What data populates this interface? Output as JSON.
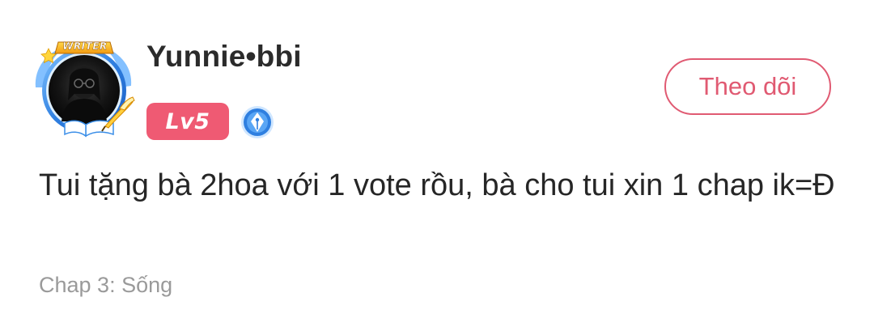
{
  "comment": {
    "avatar": {
      "frame_label": "WRITER",
      "frame_color": "#3a8ee8",
      "icon_names": [
        "writer-frame-icon",
        "quill-pen-icon",
        "open-book-icon",
        "star-icon"
      ]
    },
    "username": "Yunnie•bbi",
    "level_badge": "Lv5",
    "writer_badge_icon": "fountain-pen-nib-icon",
    "follow_button_label": "Theo dõi",
    "text": "Tui tặng bà 2hoa với 1 vote rồu, bà cho tui xin 1 chap ik=Đ",
    "chapter": "Chap 3: Sống"
  },
  "colors": {
    "accent": "#e05a72",
    "level_badge_bg": "#ef5a73",
    "text_primary": "#262626",
    "text_secondary": "#9a9a9a",
    "writer_badge_blue": "#2f7fe0"
  }
}
